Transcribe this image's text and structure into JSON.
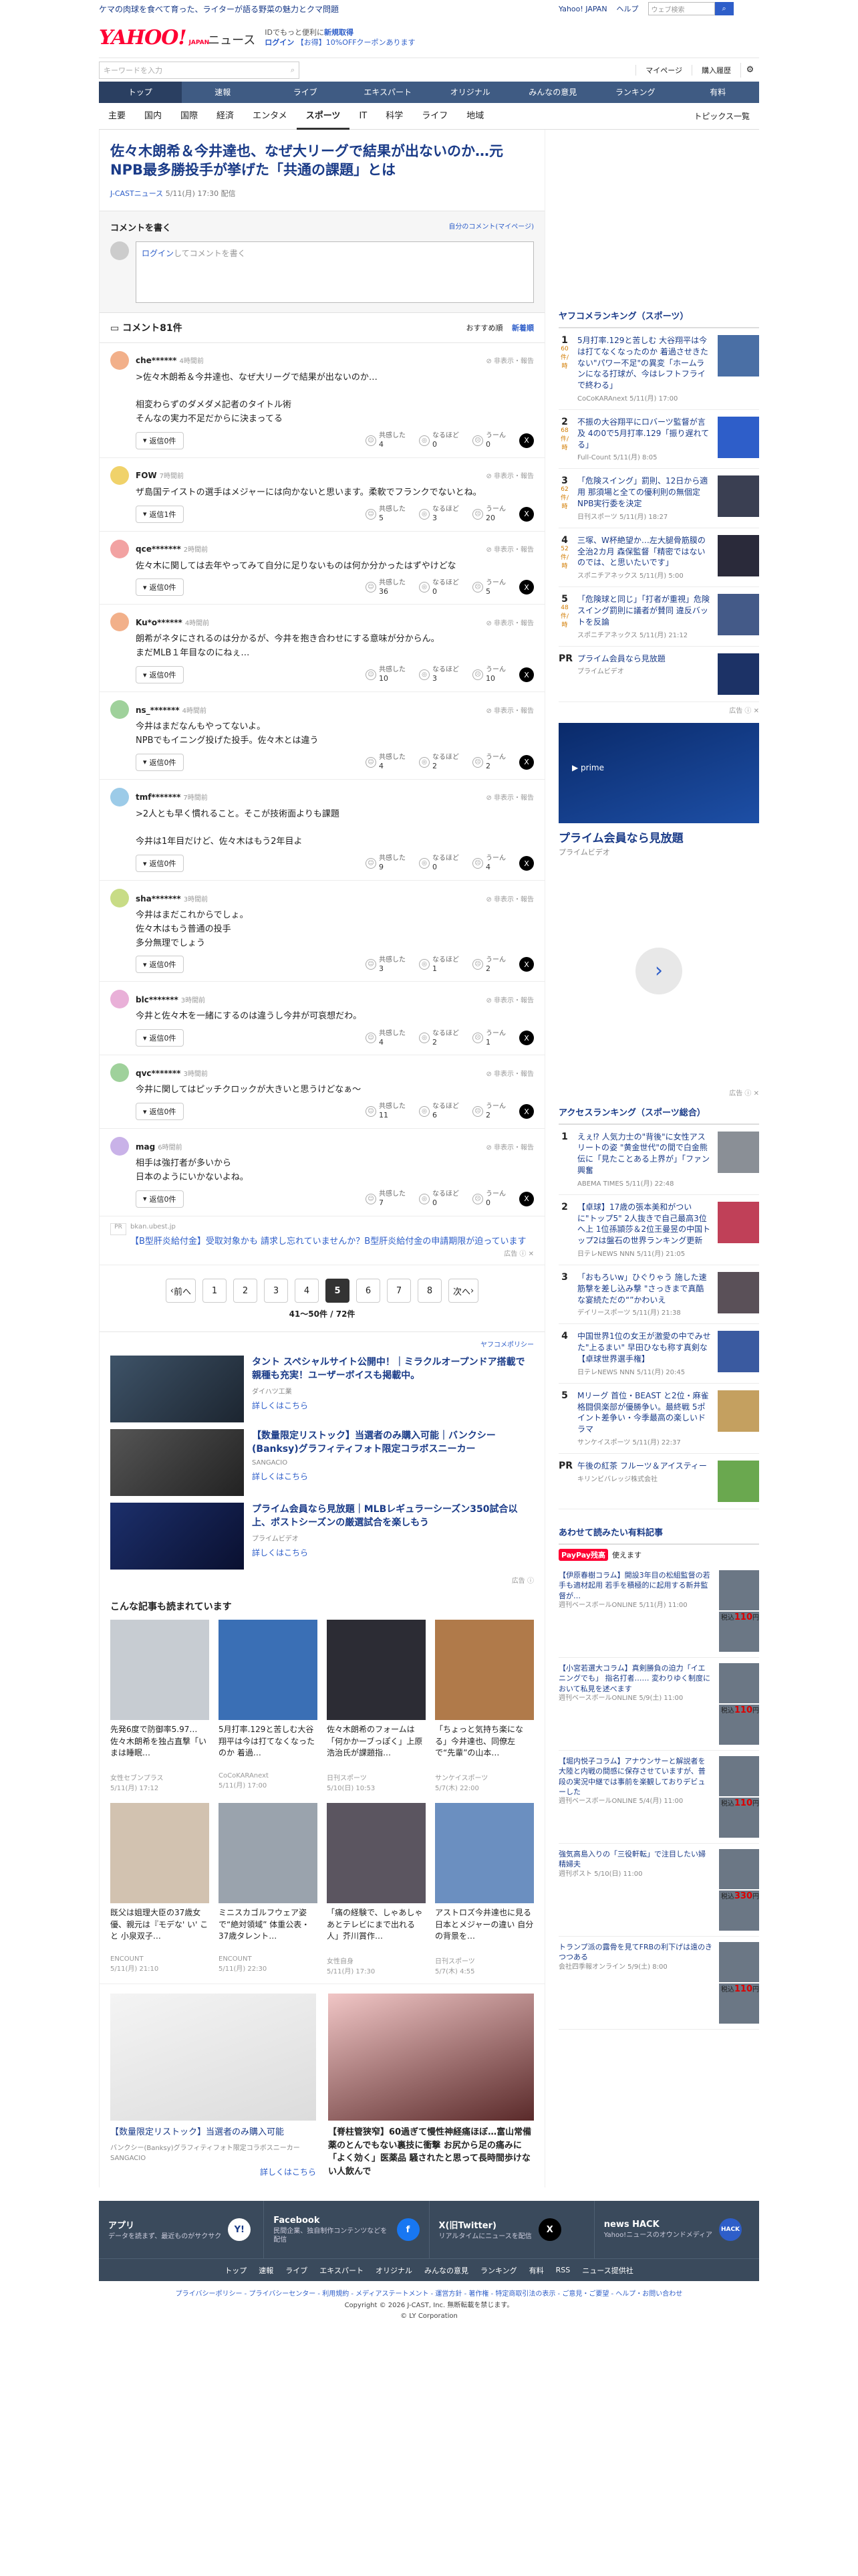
{
  "topstrip": {
    "promo": "ケマの肉球を食べて育った、ライターが語る野菜の魅力とクマ問題",
    "links": [
      "Yahoo! JAPAN",
      "ヘルプ"
    ],
    "search_placeholder": "ウェブ検索",
    "search_btn": "検索"
  },
  "logo": {
    "brand": "YAHOO!",
    "sub": "JAPAN",
    "service": "ニュース"
  },
  "promo": {
    "line1_pre": "IDでもっと便利に",
    "line1_link": "新規取得",
    "line2_a": "ログイン",
    "line2_b": "【お得】10%OFFクーポンあります"
  },
  "keyword": {
    "placeholder": "キーワードを入力"
  },
  "user_links": [
    "マイページ",
    "購入履歴"
  ],
  "mainnav": [
    "トップ",
    "速報",
    "ライブ",
    "エキスパート",
    "オリジナル",
    "みんなの意見",
    "ランキング",
    "有料"
  ],
  "subnav": [
    "主要",
    "国内",
    "国際",
    "経済",
    "エンタメ",
    "スポーツ",
    "IT",
    "科学",
    "ライフ",
    "地域"
  ],
  "subnav_right": "トピックス一覧",
  "article": {
    "title": "佐々木朗希＆今井達也、なぜ大リーグで結果が出ないのか…元NPB最多勝投手が挙げた「共通の課題」とは",
    "source": "J-CASTニュース",
    "date": "5/11(月) 17:30 配信"
  },
  "comment_write": {
    "title": "コメントを書く",
    "link": "自分のコメント(マイページ)",
    "login": "ログイン",
    "placeholder": "してコメントを書く"
  },
  "comments_head": {
    "title": "コメント81件",
    "sort_a": "おすすめ順",
    "sort_b": "新着順"
  },
  "reaction_labels": [
    "共感した",
    "なるほど",
    "うーん"
  ],
  "report_label": "非表示・報告",
  "comments": [
    {
      "name": "che******",
      "time": "4時間前",
      "body": ">佐々木朗希＆今井達也、なぜ大リーグで結果が出ないのか…\n\n相変わらずのダメダメ記者のタイトル術\nそんなの実力不足だからに決まってる",
      "reply": "返信0件",
      "r": [
        "4",
        "0",
        "0"
      ],
      "color": "#f2b08a"
    },
    {
      "name": "FOW",
      "time": "7時間前",
      "body": "ザ島国テイストの選手はメジャーには向かないと思います。柔軟でフランクでないとね。",
      "reply": "返信1件",
      "r": [
        "5",
        "3",
        "20"
      ],
      "color": "#f0d26a"
    },
    {
      "name": "qce*******",
      "time": "2時間前",
      "body": "佐々木に関しては去年やってみて自分に足りないものは何か分かったはずやけどな",
      "reply": "返信0件",
      "r": [
        "36",
        "0",
        "5"
      ],
      "color": "#f2a2a2"
    },
    {
      "name": "Ku*o******",
      "time": "4時間前",
      "body": "朗希がネタにされるのは分かるが、今井を抱き合わせにする意味が分からん。\nまだMLB１年目なのにねぇ…",
      "reply": "返信0件",
      "r": [
        "10",
        "3",
        "10"
      ],
      "color": "#f2b08a"
    },
    {
      "name": "ns_*******",
      "time": "4時間前",
      "body": "今井はまだなんもやってないよ。\nNPBでもイニング投げた投手。佐々木とは違う",
      "reply": "返信0件",
      "r": [
        "4",
        "2",
        "2"
      ],
      "color": "#9fd19b"
    },
    {
      "name": "tmf*******",
      "time": "7時間前",
      "body": ">2人とも早く慣れること。そこが技術面よりも課題\n\n今井は1年目だけど、佐々木はもう2年目よ",
      "reply": "返信0件",
      "r": [
        "9",
        "0",
        "4"
      ],
      "color": "#9ccbe8"
    },
    {
      "name": "sha*******",
      "time": "3時間前",
      "body": "今井はまだこれからでしょ。\n佐々木はもう普通の投手\n多分無理でしょう",
      "reply": "返信0件",
      "r": [
        "3",
        "1",
        "2"
      ],
      "color": "#c8dc86"
    },
    {
      "name": "blc*******",
      "time": "3時間前",
      "body": "今井と佐々木を一緒にするのは違うし今井が可哀想だわ。",
      "reply": "返信0件",
      "r": [
        "4",
        "2",
        "1"
      ],
      "color": "#e9b0d8"
    },
    {
      "name": "qvc*******",
      "time": "3時間前",
      "body": "今井に関してはピッチクロックが大きいと思うけどなぁ～",
      "reply": "返信0件",
      "r": [
        "11",
        "6",
        "2"
      ],
      "color": "#9fd19b"
    },
    {
      "name": "mag",
      "time": "6時間前",
      "body": "相手は強打者が多いから\n日本のようにいかないよね。",
      "reply": "返信0件",
      "r": [
        "7",
        "0",
        "0"
      ],
      "color": "#c9b2e8"
    }
  ],
  "adrow": {
    "source": "bkan.ubest.jp",
    "text": "【B型肝炎給付金】受取対象かも 請求し忘れていませんか？B型肝炎給付金の申請期限が迫っています",
    "tag": "広告"
  },
  "pager": {
    "prev": "前へ",
    "next": "次へ",
    "pages": [
      "1",
      "2",
      "3",
      "4",
      "5",
      "6",
      "7",
      "8"
    ],
    "current": "5",
    "count": "41〜50件 / 72件"
  },
  "sponsored": {
    "policy": "ヤフコメポリシー",
    "items": [
      {
        "title": "タント スペシャルサイト公開中！｜ミラクルオープンドア搭載で親種も充実！ユーザーボイスも掲載中。",
        "src": "ダイハツ工業",
        "more": "詳しくはこちら"
      },
      {
        "title": "【数量限定リストック】当選者のみ購入可能｜バンクシー(Banksy)グラフィティフォト限定コラボスニーカー",
        "src": "SANGACIO",
        "more": "詳しくはこちら"
      },
      {
        "title": "プライム会員なら見放題｜MLBレギュラーシーズン350試合以上、ポストシーズンの厳選試合を楽しもう",
        "src": "プライムビデオ",
        "more": "詳しくはこちら"
      }
    ],
    "tag": "広告"
  },
  "reads": {
    "title": "こんな記事も読まれています",
    "items": [
      {
        "t": "先発6度で防御率5.97…佐々木朗希を独占直撃「いまは睡眠…",
        "s": "女性セブンプラス",
        "d": "5/11(月) 17:12"
      },
      {
        "t": "5月打率.129と苦しむ大谷翔平は今は打てなくなったのか 着過…",
        "s": "CoCoKARAnext",
        "d": "5/11(月) 17:00"
      },
      {
        "t": "佐々木朗希のフォームは「何かかーブっぽく」上原浩治氏が課題指…",
        "s": "日刊スポーツ",
        "d": "5/10(日) 10:53"
      },
      {
        "t": "「ちょっと気持ち楽になる」今井達也、同僚左で“先輩”の山本…",
        "s": "サンケイスポーツ",
        "d": "5/7(木) 22:00"
      },
      {
        "t": "既父は姐理大臣の37歳女優、親元は『モデな' い' こと 小泉双子…",
        "s": "ENCOUNT",
        "d": "5/11(月) 21:10"
      },
      {
        "t": "ミニスカゴルフウェア姿で“絶対領域” 体重公表・37歳タレント…",
        "s": "ENCOUNT",
        "d": "5/11(月) 22:30"
      },
      {
        "t": "「痛の経験で、しゃあしゃあとテレビにまで出れる人」芥川賞作…",
        "s": "女性自身",
        "d": "5/11(月) 17:30"
      },
      {
        "t": "アストロズ今井達也に見る日本とメジャーの違い 自分の背景を…",
        "s": "日刊スポーツ",
        "d": "5/7(木) 4:55"
      }
    ]
  },
  "bigads": [
    {
      "t": "【数量限定リストック】当選者のみ購入可能",
      "s": "バンクシー(Banksy)グラフィティフォト限定コラボスニーカー",
      "src": "SANGACIO",
      "more": "詳しくはこちら"
    },
    {
      "t": "【脊柱管狭窄】60過ぎて慢性神経痛ほぼ…富山常備薬のとんでもない裏技に衝撃 お尻から足の痛みに「よく効く」医薬品 騒されたと思って長時間歩けない人飲んで",
      "s": "",
      "src": "",
      "more": ""
    }
  ],
  "right": {
    "rank_title": "ヤフコメランキング（スポーツ）",
    "ranks": [
      {
        "n": "1",
        "c": "60件/時",
        "t": "5月打率.129と苦しむ 大谷翔平は今は打てなくなったのか 着過させきたない\"パワー不足\"の異変「ホームランになる打球が、今はレフトフライで終わる」",
        "s": "CoCoKARAnext 5/11(月) 17:00"
      },
      {
        "n": "2",
        "c": "68件/時",
        "t": "不振の大谷翔平にロバーツ監督が言及 4の0で5月打率.129「振り遅れてる」",
        "s": "Full-Count 5/11(月) 8:05"
      },
      {
        "n": "3",
        "c": "62件/時",
        "t": "「危険スイング」罰則、12日から適用 那須場と全ての優利則の無個定NPB実行委を決定",
        "s": "日刊スポーツ 5/11(月) 18:27"
      },
      {
        "n": "4",
        "c": "52件/時",
        "t": "三塚、W杯絶望か…左大腿骨筋膜の全治2カ月 森保監督「精密ではないのでは、と思いたいです」",
        "s": "スポニチアネックス 5/11(月) 5:00"
      },
      {
        "n": "5",
        "c": "48件/時",
        "t": "「危険球と同じ」「打者が重視」危険スイング罰則に議者が賛同 違反バットを反論",
        "s": "スポニチアネックス 5/11(月) 21:12"
      },
      {
        "n": "PR",
        "c": "",
        "t": "プライム会員なら見放題",
        "s": "プライムビデオ"
      }
    ],
    "ad_tag": "広告",
    "prime_title": "プライム会員なら見放題",
    "prime_src": "プライムビデオ",
    "access_title": "アクセスランキング（スポーツ総合）",
    "access": [
      {
        "n": "1",
        "t": "えぇ⁉ 人気力士の\"背後\"に女性アスリートの姿 \"黄金世代\"の間で白金熊伝に「見たことある上界が」「ファン興奮",
        "s": "ABEMA TIMES 5/11(月) 22:48"
      },
      {
        "n": "2",
        "t": "【卓球】17歳の張本美和がついに\"トップ5\" 2人抜きで自己最高3位へ上 1位孫頴莎＆2位王曼昱の中国トップ2は盤石の世界ランキング更新",
        "s": "日テレNEWS NNN 5/11(月) 21:05"
      },
      {
        "n": "3",
        "t": "「おもろいw」ひぐりゃう 施した速筋撃を差し込み撃 \"さっきまで真酷な宴続ただの“”かわいえ",
        "s": "デイリースポーツ 5/11(月) 21:38"
      },
      {
        "n": "4",
        "t": "中国世界1位の女王が激愛の中でみせた\"上るまい\" 早田ひなも称す真剣な【卓球世界選手権】",
        "s": "日テレNEWS NNN 5/11(月) 20:45"
      },
      {
        "n": "5",
        "t": "Mリーグ 首位・BEAST と2位・麻雀格闘倶楽部が優勝争い。最終戦 5ポイント差争い・今季最高の楽しいドラマ",
        "s": "サンケイスポーツ 5/11(月) 22:37"
      },
      {
        "n": "PR",
        "t": "午後の紅茶 フルーツ＆アイスティー",
        "s": "キリンビバレッジ株式会社"
      }
    ],
    "paid_title": "あわせて読みたい有料記事",
    "paypay": "PayPay残高",
    "paypay_note": "使えます",
    "paid": [
      {
        "t": "【伊原春樹コラム】開設3年目の松組監督の若手も適材起用 若手を積極的に起用する新井監督が…",
        "s": "週刊ベースボールONLINE 5/11(月) 11:00",
        "p": "110"
      },
      {
        "t": "【小宮若選大コラム】真剣勝負の迫力「イエニングでも」 指名打者…… 変わりゆく制度において私見を述べます",
        "s": "週刊ベースボールONLINE 5/9(土) 11:00",
        "p": "110"
      },
      {
        "t": "【堀内悦子コラム】アナウンサーと解説者を大陸と内戦の間感に保存させていますが、普段の実況中継では事前を楽観しておりデビューした",
        "s": "週刊ベースボールONLINE 5/4(月) 11:00",
        "p": "110"
      },
      {
        "t": "強気高島入りの「三役軒転」で注目したい婦精婦夫",
        "s": "週刊ポスト 5/10(日) 11:00",
        "p": "330"
      },
      {
        "t": "トランプ派の露骨を見てFRBの利下げは遠のきつつある",
        "s": "会社四季報オンライン 5/9(土) 8:00",
        "p": "110"
      }
    ],
    "yen": "円",
    "price_prefix": "税込"
  },
  "apps": [
    {
      "t": "アプリ",
      "d": "データを読まず、最近ものがサクサク",
      "ic": "Y!"
    },
    {
      "t": "Facebook",
      "d": "民間企業、独自制作コンテンツなどを配信",
      "ic": "f"
    },
    {
      "t": "X(旧Twitter)",
      "d": "リアルタイムにニュースを配信",
      "ic": "X"
    },
    {
      "t": "news HACK",
      "d": "Yahoo!ニュースのオウンドメディア",
      "ic": "HACK"
    }
  ],
  "fnav": [
    "トップ",
    "速報",
    "ライブ",
    "エキスパート",
    "オリジナル",
    "みんなの意見",
    "ランキング",
    "有料",
    "RSS",
    "ニュース提供社"
  ],
  "flinks": "プライバシーポリシー - プライバシーセンター - 利用規約 - メディアステートメント - 運営方針 - 著作権 - 特定商取引法の表示 - ご意見・ご要望 - ヘルプ・お問い合わせ",
  "copy1": "Copyright © 2026 J-CAST, Inc. 無断転載を禁じます。",
  "copy2": "© LY Corporation"
}
